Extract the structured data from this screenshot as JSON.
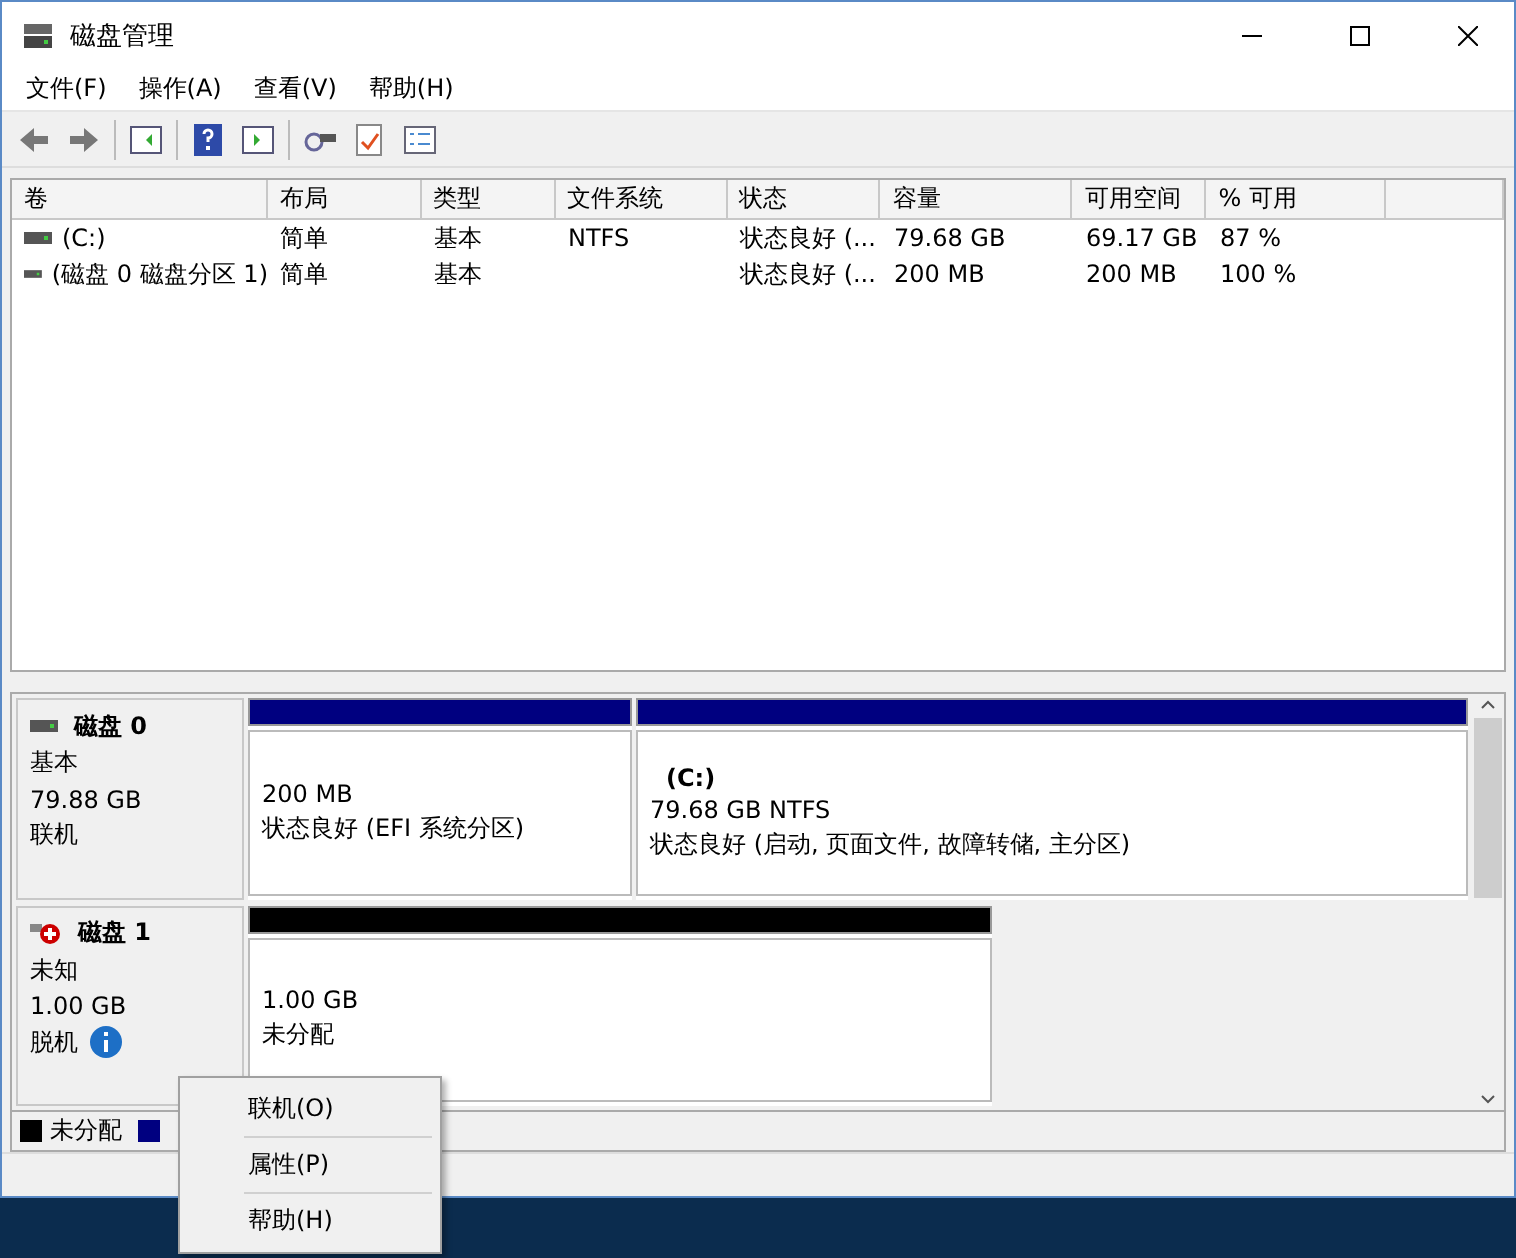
{
  "window": {
    "title": "磁盘管理"
  },
  "menu": [
    "文件(F)",
    "操作(A)",
    "查看(V)",
    "帮助(H)"
  ],
  "table": {
    "columns": [
      "卷",
      "布局",
      "类型",
      "文件系统",
      "状态",
      "容量",
      "可用空间",
      "% 可用"
    ],
    "rows": [
      [
        "(C:)",
        "简单",
        "基本",
        "NTFS",
        "状态良好 (...",
        "79.68 GB",
        "69.17 GB",
        "87 %"
      ],
      [
        "(磁盘 0 磁盘分区 1)",
        "简单",
        "基本",
        "",
        "状态良好 (...",
        "200 MB",
        "200 MB",
        "100 %"
      ]
    ]
  },
  "disks": [
    {
      "name": "磁盘 0",
      "kind": "online",
      "lines": [
        "基本",
        "79.88 GB",
        "联机"
      ],
      "partitions": [
        {
          "kind": "primary",
          "lines": [
            "200 MB",
            "状态良好 (EFI 系统分区)"
          ]
        },
        {
          "kind": "primary",
          "title": "(C:)",
          "lines": [
            "79.68 GB NTFS",
            "状态良好 (启动, 页面文件, 故障转储, 主分区)"
          ]
        }
      ]
    },
    {
      "name": "磁盘 1",
      "kind": "offline",
      "lines": [
        "未知",
        "1.00 GB",
        "脱机"
      ],
      "partitions": [
        {
          "kind": "unallocated",
          "lines": [
            "1.00 GB",
            "未分配"
          ]
        }
      ]
    }
  ],
  "legend": [
    {
      "label": "未分配",
      "color": "#000000"
    },
    {
      "color": "#000080"
    }
  ],
  "context_menu": [
    "联机(O)",
    "属性(P)",
    "帮助(H)"
  ]
}
